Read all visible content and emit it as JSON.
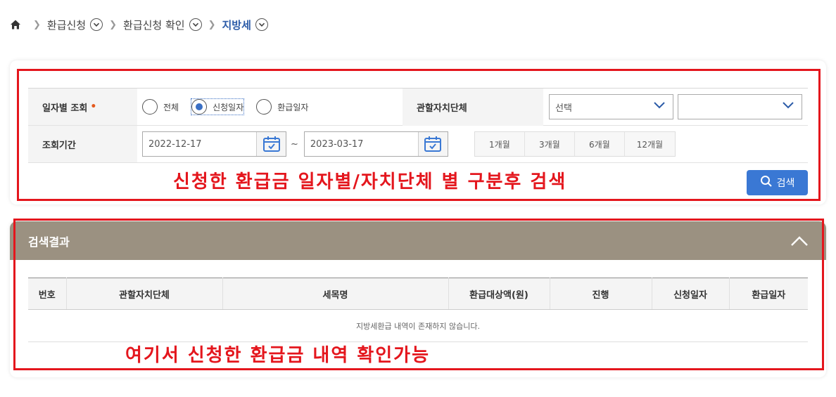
{
  "breadcrumb": {
    "items": [
      {
        "label": "환급신청"
      },
      {
        "label": "환급신청 확인"
      },
      {
        "label": "지방세"
      }
    ]
  },
  "search": {
    "date_type_label": "일자별 조회",
    "required_mark": "•",
    "radios": [
      {
        "label": "전체",
        "checked": false
      },
      {
        "label": "신청일자",
        "checked": true
      },
      {
        "label": "환급일자",
        "checked": false
      }
    ],
    "jurisdiction_label": "관할자치단체",
    "select1_value": "선택",
    "select2_value": "",
    "period_label": "조회기간",
    "date_from": "2022-12-17",
    "date_sep": "~",
    "date_to": "2023-03-17",
    "quick_periods": [
      "1개월",
      "3개월",
      "6개월",
      "12개월"
    ],
    "search_button": "검색"
  },
  "annotations": {
    "top": "신청한 환급금 일자별/자치단체 별 구분후 검색",
    "bottom": "여기서 신청한 환급금 내역 확인가능"
  },
  "results": {
    "title": "검색결과",
    "columns": [
      "번호",
      "관할자치단체",
      "세목명",
      "환급대상액(원)",
      "진행",
      "신청일자",
      "환급일자"
    ],
    "empty_message": "지방세환급 내역이 존재하지 않습니다."
  },
  "colors": {
    "accent": "#3a78d4",
    "result_header": "#9b9181",
    "annotation": "#e4161d"
  }
}
